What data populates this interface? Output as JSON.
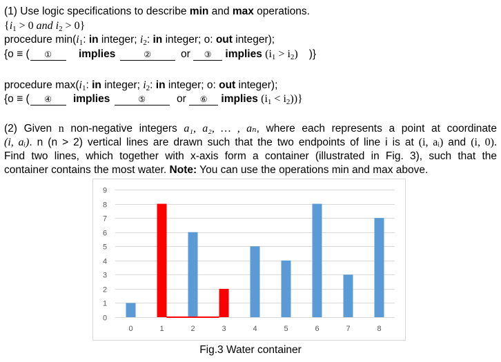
{
  "part1": {
    "intro_prefix": "(1)  Use logic specifications to describe ",
    "intro_min": "min",
    "intro_and": " and ",
    "intro_max": "max",
    "intro_suffix": " operations.",
    "precondition": {
      "open": "{",
      "i": "i",
      "sub1": "1",
      "gt0a": " > 0 ",
      "and": "and",
      "i2": " i",
      "sub2": "2",
      "gt0b": " > 0}"
    },
    "min_proc": {
      "prefix": "procedure min(",
      "i": "i",
      "sub1": "1",
      "colon1": ": ",
      "in1": "in",
      "integer1": " integer; ",
      "i2": "i",
      "sub2": "2",
      "colon2": ": ",
      "in2": "in",
      "integer2": " integer; o: ",
      "out": "out",
      "suffix": " integer);"
    },
    "min_post": {
      "prefix": "{o ≡ (",
      "blank1": "①",
      "implies1": "implies",
      "blank2": "②",
      "or": "or",
      "blank3": "③",
      "implies2": "implies",
      "cond_open": "(i",
      "sub1": "1",
      "cond_op": " > i",
      "sub2": "2",
      "cond_close": ")",
      "suffix": ")}"
    },
    "max_proc": {
      "prefix": "procedure max(",
      "i": "i",
      "sub1": "1",
      "colon1": ": ",
      "in1": "in",
      "integer1": " integer; ",
      "i2": "i",
      "sub2": "2",
      "colon2": ": ",
      "in2": "in",
      "integer2": " integer; o: ",
      "out": "out",
      "suffix": " integer);"
    },
    "max_post": {
      "prefix": "{o ≡ (",
      "blank4": "④",
      "implies1": "implies",
      "blank5": "⑤",
      "or": "or",
      "blank6": "⑥",
      "implies2": "implies",
      "cond_open": "(i",
      "sub1": "1",
      "cond_op": " < i",
      "sub2": "2",
      "cond_close": "))}"
    }
  },
  "part2": {
    "line1_a": "(2) Given ",
    "line1_n": "n",
    "line1_b": " non-negative integers ",
    "line1_seq": "a₁, a₂, … , aₙ",
    "line1_c": ", where each represents a point at coordinate",
    "line2_coord": "(i, aᵢ)",
    "line2_a": ". n (n > 2) vertical lines are drawn such that the two endpoints of line i is at ",
    "line2_p1": "(i, aᵢ)",
    "line2_and": " and ",
    "line2_p2": "(i, 0).",
    "line3": "Find two lines, which together with x-axis form a container (illustrated in Fig. 3), such that the",
    "line4_a": "container contains the most water. ",
    "line4_note": "Note:",
    "line4_b": " You can use the operations min and max above."
  },
  "chart_data": {
    "type": "bar",
    "title": "",
    "categories": [
      "0",
      "1",
      "2",
      "3",
      "4",
      "5",
      "6",
      "7",
      "8"
    ],
    "values": [
      1,
      8,
      6,
      2,
      5,
      4,
      8,
      3,
      7
    ],
    "highlighted": [
      1,
      3
    ],
    "container_base": {
      "from": 1,
      "to": 3,
      "y": 0
    },
    "xlabel": "",
    "ylabel": "",
    "ylim": [
      0,
      9
    ],
    "yticks": [
      "0",
      "1",
      "2",
      "3",
      "4",
      "5",
      "6",
      "7",
      "8",
      "9"
    ],
    "grid": true,
    "legend": "none",
    "colors": {
      "default": "#5b9bd5",
      "highlight": "#ff0000",
      "grid": "#d9d9d9",
      "tick_text": "#595959"
    }
  },
  "caption": "Fig.3 Water container"
}
